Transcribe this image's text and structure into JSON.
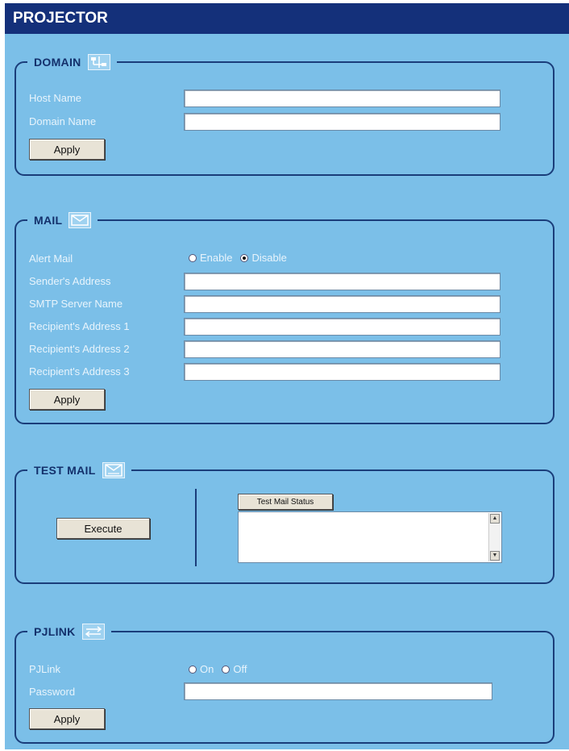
{
  "header": {
    "title": "PROJECTOR"
  },
  "domain": {
    "title": "DOMAIN",
    "icon": "network-icon",
    "fields": [
      {
        "label": "Host Name",
        "value": ""
      },
      {
        "label": "Domain Name",
        "value": ""
      }
    ],
    "apply_label": "Apply"
  },
  "mail": {
    "title": "MAIL",
    "icon": "envelope-icon",
    "alert_label": "Alert Mail",
    "alert_options": [
      "Enable",
      "Disable"
    ],
    "alert_selected": "Disable",
    "fields": [
      {
        "label": "Sender's Address",
        "value": ""
      },
      {
        "label": "SMTP Server Name",
        "value": ""
      },
      {
        "label": "Recipient's Address 1",
        "value": ""
      },
      {
        "label": "Recipient's Address 2",
        "value": ""
      },
      {
        "label": "Recipient's Address 3",
        "value": ""
      }
    ],
    "apply_label": "Apply"
  },
  "test_mail": {
    "title": "TEST MAIL",
    "icon": "envelope-test-icon",
    "execute_label": "Execute",
    "status_label": "Test Mail Status",
    "status_text": ""
  },
  "pjlink": {
    "title": "PJLINK",
    "icon": "link-arrows-icon",
    "pjlink_label": "PJLink",
    "options": [
      "On",
      "Off"
    ],
    "password_label": "Password",
    "password_value": "",
    "apply_label": "Apply"
  },
  "colors": {
    "panel_background": "#7bbfe8",
    "header_background": "#14307a",
    "border": "#1a3d7a",
    "label_text": "#e8f4fc"
  }
}
